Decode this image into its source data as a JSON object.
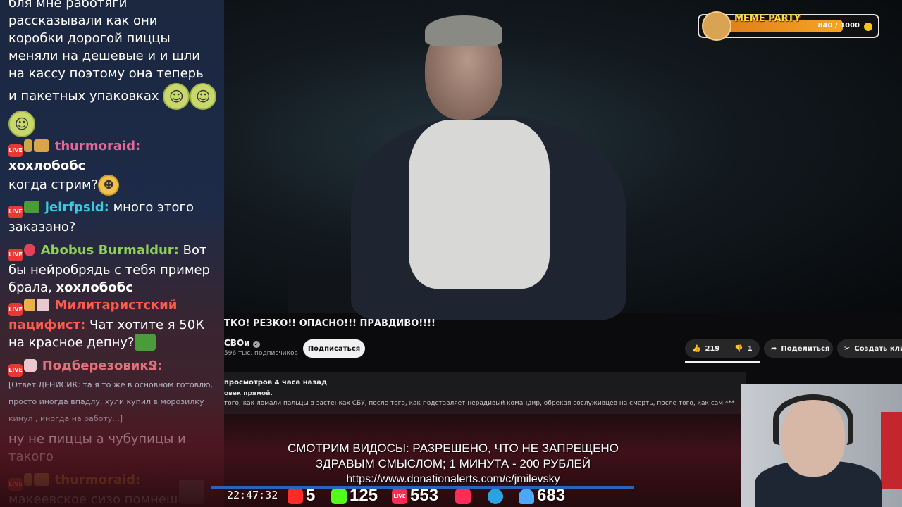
{
  "chat": {
    "messages": [
      {
        "type": "text",
        "text": "бля мне работяги"
      },
      {
        "type": "text",
        "text": "рассказывали как они"
      },
      {
        "type": "text",
        "text": "коробки дорогой пиццы"
      },
      {
        "type": "text",
        "text": "меняли на дешевые и и шли"
      },
      {
        "type": "text",
        "text": "на кассу поэтому она теперь"
      },
      {
        "type": "text",
        "text": "и пакетных упаковках"
      }
    ],
    "m1": {
      "user": "thurmoraid:",
      "user_color": "#e06a9a",
      "text": "хохлобобс",
      "text2": "когда стрим?"
    },
    "m2": {
      "user": "jeirfpsld:",
      "user_color": "#3bc9e0",
      "text": "много этого",
      "text2": "заказано?"
    },
    "m3": {
      "user": "Abobus Burmaldur:",
      "user_color": "#8fcf5a",
      "text": "Вот",
      "text2": "бы нейробрядь с тебя пример",
      "text3": "брала,",
      "mention": "хохлобобс"
    },
    "m4": {
      "user": "Милитаристский",
      "user2": "пацифист:",
      "user_color": "#ff5a4a",
      "text": "Чат хотите я 50К",
      "text2": "на красное депну?"
    },
    "m5": {
      "user": "ПодберезовикՋ:",
      "user_color": "#e0707a",
      "reply1": "[Ответ ДЕНИСИК: та я то же в основном готовлю,",
      "reply2": "просто иногда впадлу, хули купил в морозилку",
      "reply3": "кинул , иногда на работу...]",
      "text": "ну не пиццы а чубупицы и",
      "text2": "такого"
    },
    "m6": {
      "user": "thurmoraid:",
      "user_color": "#e8a23a",
      "text": "макеевское сизо помнеш"
    },
    "live_label": "LIVE"
  },
  "video": {
    "title": "ТКО! РЕЗКО!! ОПАСНО!!! ПРАВДИВО!!!!",
    "channel": "СВОи",
    "subscribers": "596 тыс. подписчиков",
    "subscribe_label": "Подписаться",
    "likes": "219",
    "dislikes": "1",
    "share_label": "Поделиться",
    "create_label": "Создать кли",
    "views_meta": "просмотров  4 часа назад",
    "desc_line1": "овек прямой.",
    "desc_line2": "того, как ломали пальцы в застенках СБУ, после того, как подставляет нерадивый командир, обрекая сослуживцев на смерть, после того, как сам ***"
  },
  "meme_party": {
    "title": "MEME PARTY",
    "value": "840 / 1000",
    "progress_fraction": 0.84
  },
  "donation": {
    "line1": "СМОТРИМ ВИДОСЫ: РАЗРЕШЕНО, ЧТО НЕ ЗАПРЕЩЕНО",
    "line2": "ЗДРАВЫМ СМЫСЛОМ; 1 МИНУТА - 200 РУБЛЕЙ",
    "url": "https://www.donationalerts.com/c/jmilevsky"
  },
  "status": {
    "clock": "22:47:32",
    "youtube_viewers": "5",
    "kick_viewers": "125",
    "vk_live_viewers": "553",
    "total_viewers": "683",
    "colors": {
      "youtube": "#ff2a2a",
      "kick": "#53fc18",
      "vk_live": "#ff2d55",
      "telegram": "#2aa3e0",
      "viewers": "#4aa8ff"
    }
  }
}
